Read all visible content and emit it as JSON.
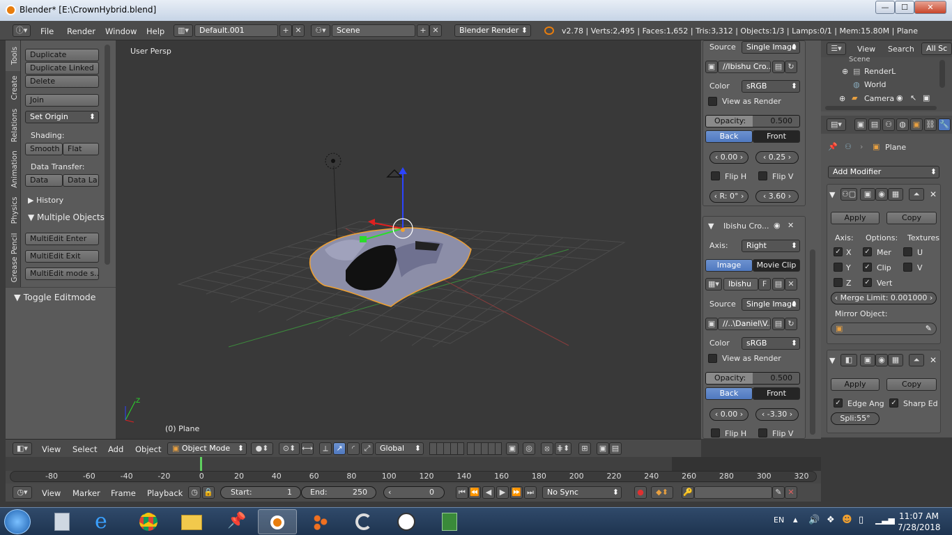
{
  "window": {
    "title": "Blender* [E:\\CrownHybrid.blend]",
    "min": "—",
    "max": "☐",
    "close": "✕"
  },
  "infobar": {
    "menus": [
      "File",
      "Render",
      "Window",
      "Help"
    ],
    "layout": "Default.001",
    "scene": "Scene",
    "engine": "Blender Render",
    "stats": "v2.78 | Verts:2,495 | Faces:1,652 | Tris:3,312 | Objects:1/3 | Lamps:0/1 | Mem:15.80M | Plane"
  },
  "toolshelf": {
    "tabs": [
      "Tools",
      "Create",
      "Relations",
      "Animation",
      "Physics",
      "Grease Pencil"
    ],
    "duplicate": "Duplicate",
    "duplicate_linked": "Duplicate Linked",
    "delete": "Delete",
    "join": "Join",
    "set_origin": "Set Origin",
    "shading_label": "Shading:",
    "smooth": "Smooth",
    "flat": "Flat",
    "data_transfer_label": "Data Transfer:",
    "data": "Data",
    "data_la": "Data La",
    "history": "History",
    "multiple_objects": "Multiple Objects",
    "multiedit_enter": "MultiEdit Enter",
    "multiedit_exit": "MultiEdit Exit",
    "multiedit_mode": "MultiEdit mode s...",
    "toggle_editmode": "Toggle Editmode"
  },
  "viewport": {
    "view_label": "User Persp",
    "object_label": "(0) Plane"
  },
  "bgimages": {
    "source_label": "Source",
    "source_value": "Single Image",
    "path1": "//Ibishu Cro...",
    "color_label": "Color",
    "color_value": "sRGB",
    "view_as_render": "View as Render",
    "opacity_label": "Opacity:",
    "opacity_value": "0.500",
    "back": "Back",
    "front": "Front",
    "x1": "0.00",
    "y1": "0.25",
    "flip_h": "Flip H",
    "flip_v": "Flip V",
    "rot": "R: 0°",
    "size": "3.60",
    "image2_name": "Ibishu Cro...",
    "axis_label": "Axis:",
    "axis_value": "Right",
    "image_tab": "Image",
    "movie_clip_tab": "Movie Clip",
    "img_field": "Ibishu",
    "f_btn": "F",
    "path2": "//..\\Daniel\\V...",
    "x2": "0.00",
    "y2": "-3.30"
  },
  "outliner": {
    "view": "View",
    "search": "Search",
    "all_scenes": "All Sc",
    "items": [
      "Scene",
      "RenderL",
      "World",
      "Camera"
    ]
  },
  "properties": {
    "object_name": "Plane",
    "add_modifier": "Add Modifier",
    "apply": "Apply",
    "copy": "Copy",
    "axis_label": "Axis:",
    "options_label": "Options:",
    "textures_label": "Textures",
    "x": "X",
    "y": "Y",
    "z": "Z",
    "mer": "Mer",
    "clip": "Clip",
    "vert": "Vert",
    "u": "U",
    "v": "V",
    "merge_limit": "Merge Limit:",
    "merge_value": "0.001000",
    "mirror_object": "Mirror Object:",
    "apply2": "Apply",
    "copy2": "Copy",
    "edge_ang": "Edge Ang",
    "sharp_ed": "Sharp Ed",
    "split": "Spli:55°"
  },
  "view_header": {
    "menus": [
      "View",
      "Select",
      "Add",
      "Object"
    ],
    "mode": "Object Mode",
    "orientation": "Global"
  },
  "timeline": {
    "ticks": [
      "-80",
      "-60",
      "-40",
      "-20",
      "0",
      "20",
      "40",
      "60",
      "80",
      "100",
      "120",
      "140",
      "160",
      "180",
      "200",
      "220",
      "240",
      "260",
      "280",
      "300",
      "320"
    ],
    "menus": [
      "View",
      "Marker",
      "Frame",
      "Playback"
    ],
    "start_label": "Start:",
    "start_value": "1",
    "end_label": "End:",
    "end_value": "250",
    "current": "0",
    "sync": "No Sync"
  },
  "taskbar": {
    "lang": "EN",
    "time": "11:07 AM",
    "date": "7/28/2018"
  }
}
